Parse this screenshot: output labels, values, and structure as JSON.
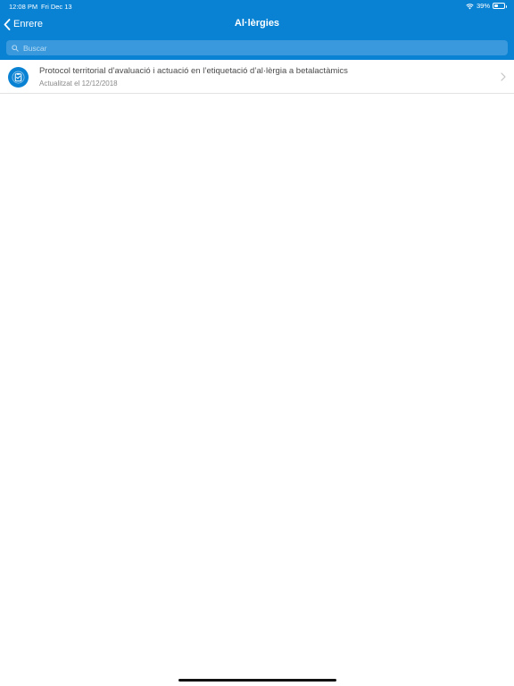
{
  "status_bar": {
    "time": "12:08 PM",
    "date": "Fri Dec 13",
    "battery": "39%"
  },
  "nav": {
    "back_label": "Enrere",
    "title": "Al·lèrgies"
  },
  "search": {
    "placeholder": "Buscar"
  },
  "list": {
    "items": [
      {
        "title": "Protocol territorial d’avaluació i actuació en l’etiquetació d’al·lèrgia a betalactàmics",
        "subtitle": "Actualitzat el 12/12/2018",
        "icon": "document-clipboard-icon"
      }
    ]
  },
  "colors": {
    "header": "#0a82d3",
    "search_field": "#3a99dc",
    "icon_bg": "#0a82d3"
  }
}
